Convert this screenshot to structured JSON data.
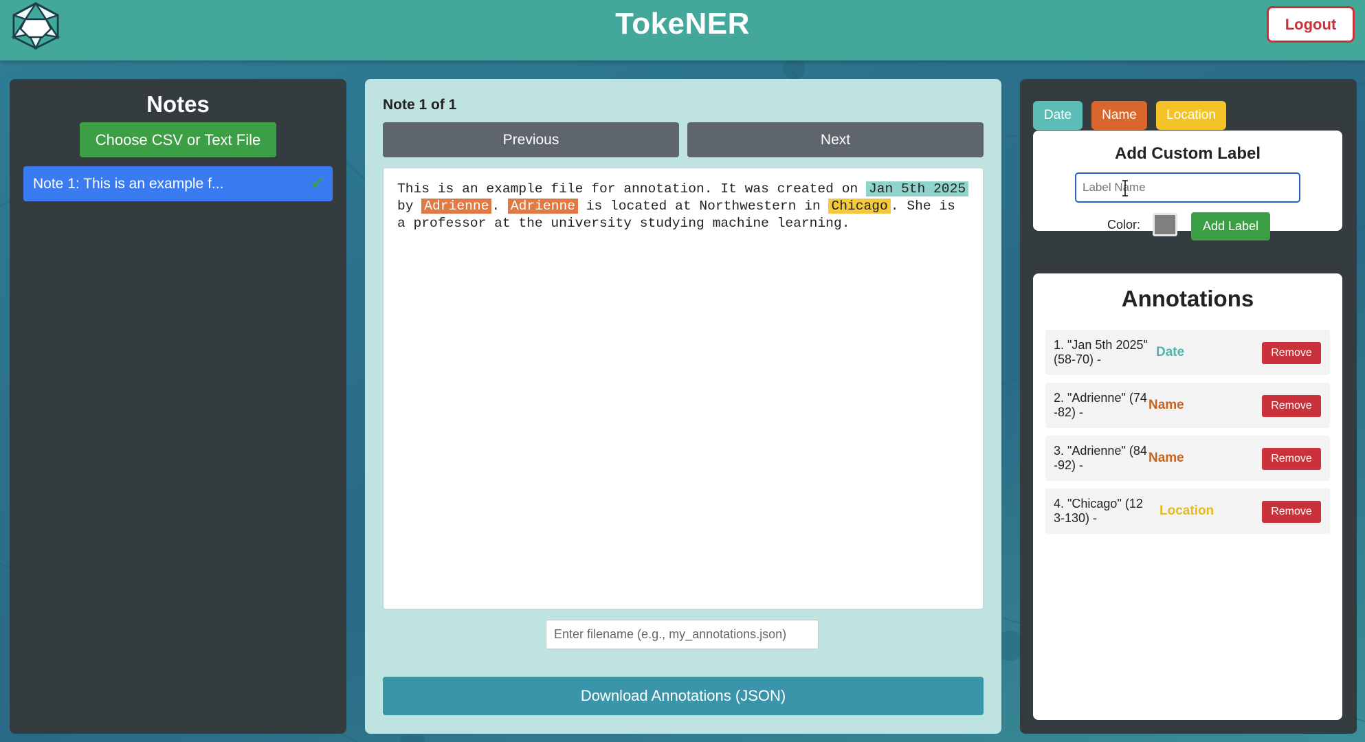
{
  "app": {
    "title": "TokeNER",
    "logout_label": "Logout"
  },
  "notes": {
    "title": "Notes",
    "choose_file_label": "Choose CSV or Text File",
    "items": [
      {
        "label": "Note 1: This is an example f...",
        "done": true
      }
    ]
  },
  "editor": {
    "counter": "Note 1 of 1",
    "previous_label": "Previous",
    "next_label": "Next",
    "segments": [
      {
        "text": "This is an example file for annotation. It was created on ",
        "type": "plain"
      },
      {
        "text": "Jan 5th 2025",
        "type": "date"
      },
      {
        "text": " by ",
        "type": "plain"
      },
      {
        "text": "Adrienne",
        "type": "name"
      },
      {
        "text": ". ",
        "type": "plain"
      },
      {
        "text": "Adrienne",
        "type": "name"
      },
      {
        "text": " is located at Northwestern in ",
        "type": "plain"
      },
      {
        "text": "Chicago",
        "type": "location"
      },
      {
        "text": ". She is a professor at the university studying machine learning.",
        "type": "plain"
      }
    ],
    "filename_placeholder": "Enter filename (e.g., my_annotations.json)",
    "download_label": "Download Annotations (JSON)"
  },
  "labels": {
    "chips": [
      "Date",
      "Name",
      "Location"
    ],
    "colors": {
      "Date": "#5bbdb5",
      "Name": "#d9672d",
      "Location": "#f3c227"
    }
  },
  "custom_label": {
    "title": "Add Custom Label",
    "input_placeholder": "Label Name",
    "color_label": "Color:",
    "color_value": "#7f7f7f",
    "add_label": "Add Label"
  },
  "annotations": {
    "title": "Annotations",
    "remove_label": "Remove",
    "items": [
      {
        "text": "1. \"Jan 5th 2025\" (58-70) -",
        "label": "Date",
        "label_color": "#4fb3ab"
      },
      {
        "text": "2. \"Adrienne\" (74-82) -",
        "label": "Name",
        "label_color": "#c8621f"
      },
      {
        "text": "3. \"Adrienne\" (84-92) -",
        "label": "Name",
        "label_color": "#c8621f"
      },
      {
        "text": "4. \"Chicago\" (123-130) -",
        "label": "Location",
        "label_color": "#e8b91b"
      }
    ]
  }
}
